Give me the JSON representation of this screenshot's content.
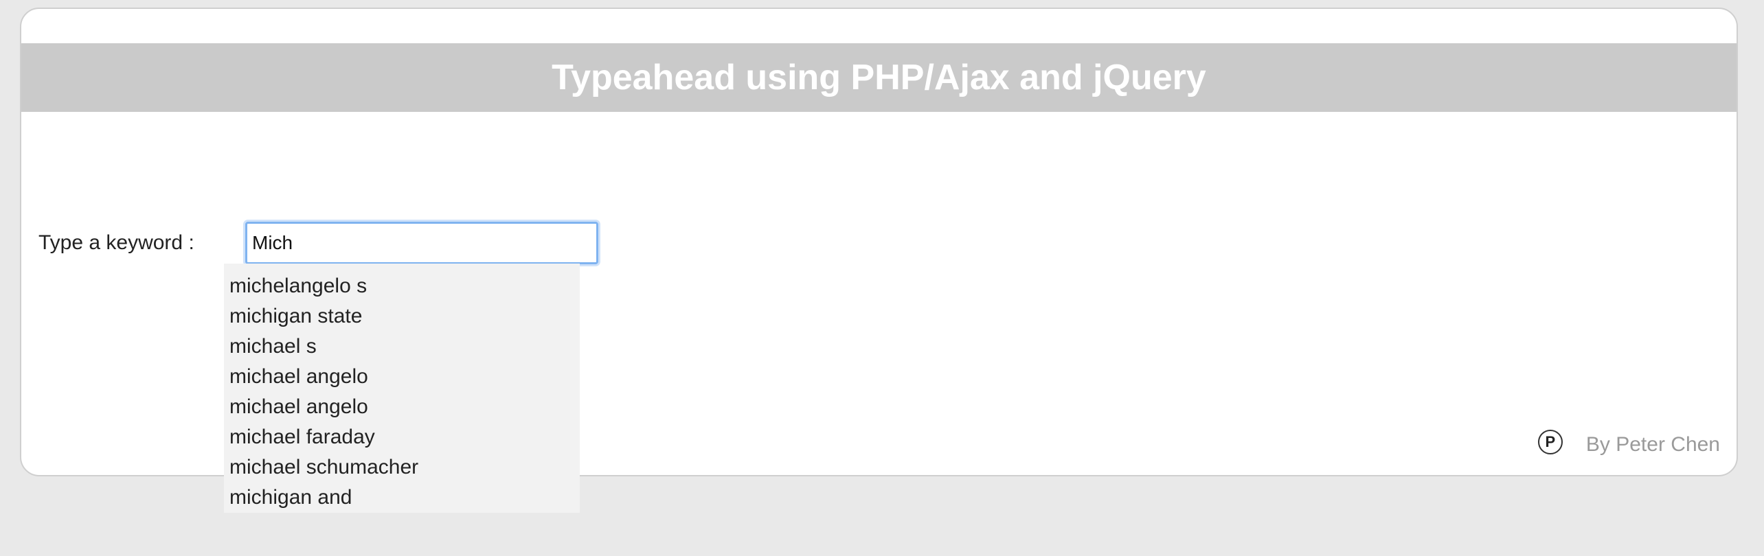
{
  "header": {
    "title": "Typeahead using PHP/Ajax and jQuery"
  },
  "form": {
    "label": "Type a keyword :",
    "input_value": "Mich"
  },
  "suggestions": [
    "michelangelo s",
    "michigan state",
    "michael s",
    "michael angelo",
    "michael angelo",
    "michael faraday",
    "michael schumacher",
    "michigan and"
  ],
  "footer": {
    "icon_letter": "P",
    "icon_name": "p-circle-icon",
    "byline": "By Peter Chen"
  },
  "colors": {
    "page_background": "#e9e9e9",
    "header_background": "#cacaca",
    "input_focus_border": "#7fb3f0",
    "dropdown_background": "#f2f2f2",
    "byline_text": "#9a9a9a"
  }
}
